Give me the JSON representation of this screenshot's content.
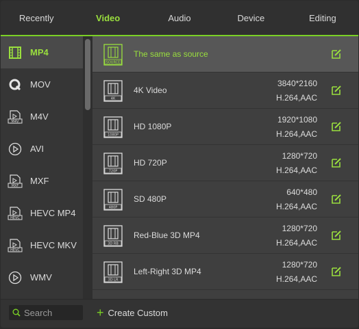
{
  "tabs": [
    {
      "label": "Recently"
    },
    {
      "label": "Video",
      "active": true
    },
    {
      "label": "Audio"
    },
    {
      "label": "Device"
    },
    {
      "label": "Editing"
    }
  ],
  "sidebar": {
    "items": [
      {
        "label": "MP4",
        "icon": "film-icon",
        "active": true
      },
      {
        "label": "MOV",
        "icon": "quicktime-icon"
      },
      {
        "label": "M4V",
        "icon": "m4v-file-icon",
        "badge": "M4V"
      },
      {
        "label": "AVI",
        "icon": "play-circle-icon"
      },
      {
        "label": "MXF",
        "icon": "mxf-file-icon",
        "badge": "MXF"
      },
      {
        "label": "HEVC MP4",
        "icon": "hevc-file-icon",
        "badge": "HEVC"
      },
      {
        "label": "HEVC MKV",
        "icon": "hevc-file-icon",
        "badge": "HEVC"
      },
      {
        "label": "WMV",
        "icon": "play-circle-icon"
      }
    ]
  },
  "formats": [
    {
      "name": "The same as source",
      "badge": "SOURCE",
      "res": "",
      "codec": "",
      "active": true
    },
    {
      "name": "4K Video",
      "badge": "4K",
      "res": "3840*2160",
      "codec": "H.264,AAC"
    },
    {
      "name": "HD 1080P",
      "badge": "1080P",
      "res": "1920*1080",
      "codec": "H.264,AAC"
    },
    {
      "name": "HD 720P",
      "badge": "720P",
      "res": "1280*720",
      "codec": "H.264,AAC"
    },
    {
      "name": "SD 480P",
      "badge": "480P",
      "res": "640*480",
      "codec": "H.264,AAC"
    },
    {
      "name": "Red-Blue 3D MP4",
      "badge": "3D RB",
      "res": "1280*720",
      "codec": "H.264,AAC"
    },
    {
      "name": "Left-Right 3D MP4",
      "badge": "3D LR",
      "res": "1280*720",
      "codec": "H.264,AAC"
    }
  ],
  "footer": {
    "search_placeholder": "Search",
    "create_label": "Create Custom"
  },
  "colors": {
    "accent": "#7bd125",
    "text": "#dcdcdc"
  }
}
